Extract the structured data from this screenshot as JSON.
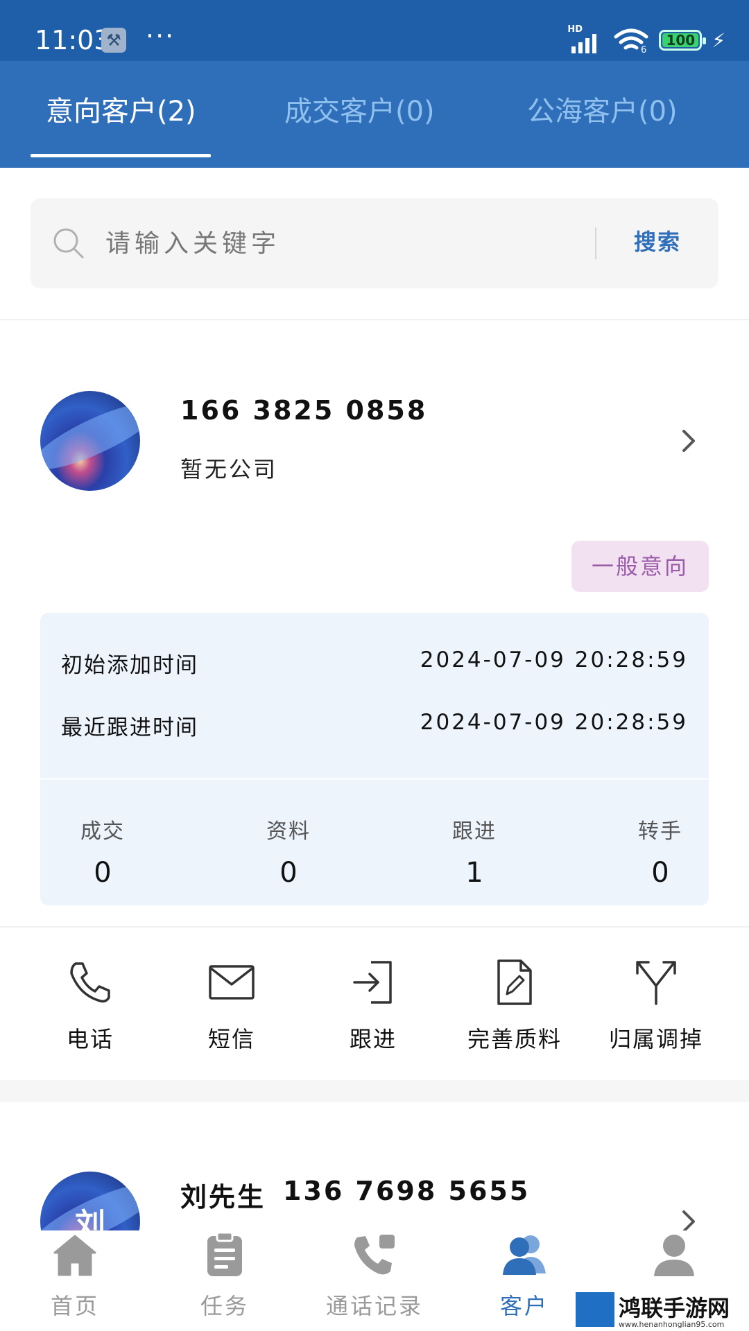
{
  "status_bar": {
    "time": "11:03",
    "dots": "···",
    "network": "HD",
    "wifi_badge": "6",
    "battery": "100"
  },
  "tabs": [
    {
      "label": "意向客户(2)",
      "active": true
    },
    {
      "label": "成交客户(0)",
      "active": false
    },
    {
      "label": "公海客户(0)",
      "active": false
    }
  ],
  "search": {
    "placeholder": "请输入关键字",
    "button": "搜索"
  },
  "customers": [
    {
      "avatar_initial": "",
      "name": "",
      "phone": "166 3825 0858",
      "company": "暂无公司",
      "tag": "一般意向",
      "info": [
        {
          "label": "初始添加时间",
          "value": "2024-07-09 20:28:59"
        },
        {
          "label": "最近跟进时间",
          "value": "2024-07-09 20:28:59"
        }
      ],
      "stats": [
        {
          "label": "成交",
          "value": "0"
        },
        {
          "label": "资料",
          "value": "0"
        },
        {
          "label": "跟进",
          "value": "1"
        },
        {
          "label": "转手",
          "value": "0"
        }
      ]
    },
    {
      "avatar_initial": "刘",
      "name": "刘先生",
      "phone": "136 7698 5655"
    }
  ],
  "actions": [
    {
      "label": "电话",
      "icon": "phone-icon"
    },
    {
      "label": "短信",
      "icon": "envelope-icon"
    },
    {
      "label": "跟进",
      "icon": "follow-up-icon"
    },
    {
      "label": "完善质料",
      "icon": "edit-document-icon"
    },
    {
      "label": "归属调掉",
      "icon": "split-arrows-icon"
    }
  ],
  "bottom_nav": [
    {
      "label": "首页",
      "icon": "home-icon",
      "active": false
    },
    {
      "label": "任务",
      "icon": "clipboard-icon",
      "active": false
    },
    {
      "label": "通话记录",
      "icon": "call-log-icon",
      "active": false
    },
    {
      "label": "客户",
      "icon": "customers-icon",
      "active": true
    },
    {
      "label": "",
      "icon": "profile-icon",
      "active": false
    }
  ],
  "watermark": {
    "title": "鸿联手游网",
    "url": "www.henanhonglian95.com"
  },
  "colors": {
    "header_blue": "#2f6fba",
    "statusbar_blue": "#1f5ea9",
    "accent_blue": "#2f6fba",
    "tag_bg": "#f1e1f1",
    "tag_text": "#9a5ba8",
    "info_bg": "#edf4fc"
  }
}
